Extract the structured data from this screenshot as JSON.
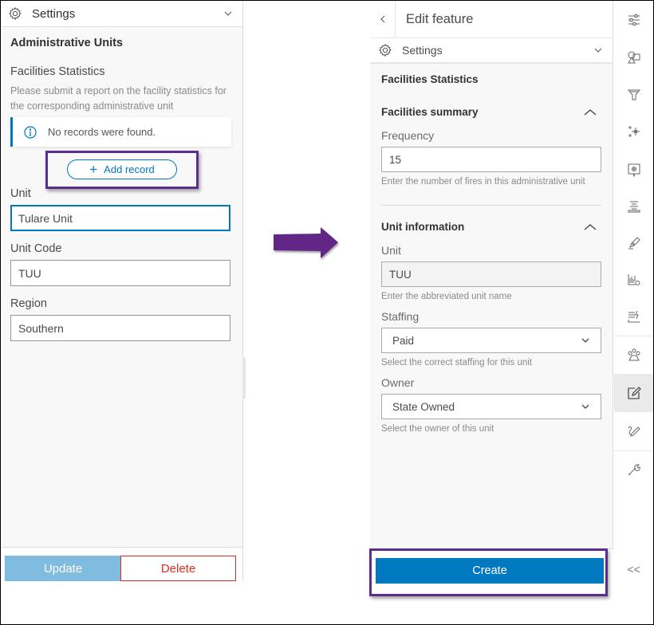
{
  "left_panel": {
    "header_title": "Settings",
    "section_title": "Administrative Units",
    "group_title": "Facilities Statistics",
    "group_description": "Please submit a report on the facility statistics for the corresponding administrative unit",
    "notice_text": "No records were found.",
    "add_record_label": "Add record",
    "fields": [
      {
        "label": "Unit",
        "value": "Tulare Unit",
        "focused": true
      },
      {
        "label": "Unit Code",
        "value": "TUU"
      },
      {
        "label": "Region",
        "value": "Southern"
      }
    ],
    "update_label": "Update",
    "delete_label": "Delete"
  },
  "right_panel": {
    "title": "Edit feature",
    "settings_title": "Settings",
    "section_title": "Facilities Statistics",
    "groups": [
      {
        "title": "Facilities summary",
        "fields": [
          {
            "label": "Frequency",
            "value": "15",
            "hint": "Enter the number of fires in this administrative unit"
          }
        ]
      },
      {
        "title": "Unit information",
        "fields": [
          {
            "label": "Unit",
            "value": "TUU",
            "hint": "Enter the abbreviated unit name",
            "readonly": true
          },
          {
            "label": "Staffing",
            "value": "Paid",
            "hint": "Select the correct staffing for this unit",
            "type": "select"
          },
          {
            "label": "Owner",
            "value": "State Owned",
            "hint": "Select the owner of this unit",
            "type": "select"
          }
        ]
      }
    ],
    "create_label": "Create"
  },
  "icon_strip": {
    "items": [
      "sliders-icon",
      "basemap-icon",
      "filter-icon",
      "sparkle-icon",
      "settings-badge-icon",
      "legend-icon",
      "sketch-icon",
      "chart-settings-icon",
      "attribute-table-icon",
      "group-icon",
      "edit-icon",
      "measure-icon",
      "wrench-icon"
    ],
    "active": "edit-icon",
    "collapse_label": "<<"
  },
  "colors": {
    "accent": "#0079c1",
    "highlight": "#5c2d91",
    "danger": "#d83020"
  }
}
